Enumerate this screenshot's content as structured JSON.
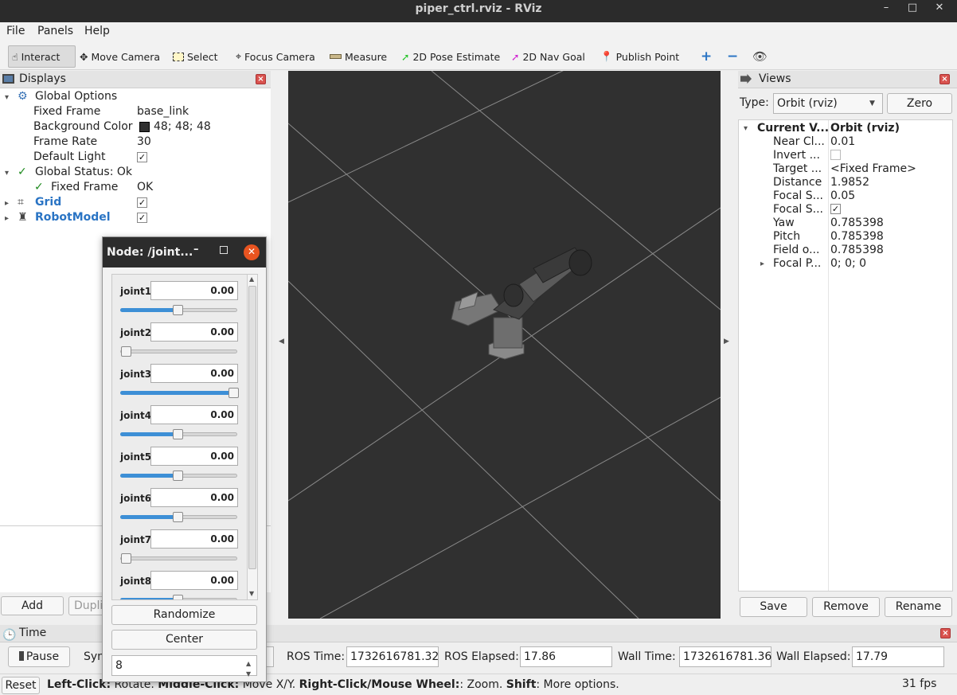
{
  "window": {
    "title": "piper_ctrl.rviz - RViz",
    "min": "–",
    "max": "□",
    "close": "✕"
  },
  "menu": {
    "file": "File",
    "panels": "Panels",
    "help": "Help"
  },
  "toolbar": {
    "interact": "Interact",
    "move_camera": "Move Camera",
    "select": "Select",
    "focus_camera": "Focus Camera",
    "measure": "Measure",
    "pose_estimate": "2D Pose Estimate",
    "nav_goal": "2D Nav Goal",
    "publish_point": "Publish Point"
  },
  "displays": {
    "title": "Displays",
    "global_options": "Global Options",
    "fixed_frame_label": "Fixed Frame",
    "fixed_frame_value": "base_link",
    "background_color_label": "Background Color",
    "background_color_value": "48; 48; 48",
    "background_swatch": "#303030",
    "frame_rate_label": "Frame Rate",
    "frame_rate_value": "30",
    "default_light_label": "Default Light",
    "global_status": "Global Status: Ok",
    "status_fixed_frame": "Fixed Frame",
    "status_fixed_frame_value": "OK",
    "grid": "Grid",
    "robot_model": "RobotModel",
    "add_button": "Add",
    "duplicate_button": "Dupli"
  },
  "node": {
    "title": "Node: /joint...",
    "joints": [
      {
        "name": "joint1",
        "value": "0.00",
        "level": 0.5
      },
      {
        "name": "joint2",
        "value": "0.00",
        "level": 0.0
      },
      {
        "name": "joint3",
        "value": "0.00",
        "level": 1.0
      },
      {
        "name": "joint4",
        "value": "0.00",
        "level": 0.5
      },
      {
        "name": "joint5",
        "value": "0.00",
        "level": 0.5
      },
      {
        "name": "joint6",
        "value": "0.00",
        "level": 0.5
      },
      {
        "name": "joint7",
        "value": "0.00",
        "level": 0.0
      },
      {
        "name": "joint8",
        "value": "0.00",
        "level": 0.5
      }
    ],
    "randomize": "Randomize",
    "center": "Center",
    "spin_value": "8"
  },
  "views": {
    "title": "Views",
    "type_label": "Type:",
    "type_value": "Orbit (rviz)",
    "zero_button": "Zero",
    "current_view": "Current V...",
    "current_view_value": "Orbit (rviz)",
    "near_clip": "Near Cl...",
    "near_clip_value": "0.01",
    "invert": "Invert ...",
    "target": "Target ...",
    "target_value": "<Fixed Frame>",
    "distance": "Distance",
    "distance_value": "1.9852",
    "focal_size": "Focal S...",
    "focal_size_value": "0.05",
    "focal_shape": "Focal S...",
    "yaw": "Yaw",
    "yaw_value": "0.785398",
    "pitch": "Pitch",
    "pitch_value": "0.785398",
    "fov": "Field o...",
    "fov_value": "0.785398",
    "focal_point": "Focal P...",
    "focal_point_value": "0; 0; 0",
    "save": "Save",
    "remove": "Remove",
    "rename": "Rename"
  },
  "time": {
    "title": "Time",
    "pause": "Pause",
    "sync": "Syn",
    "ros_time_label": "ROS Time:",
    "ros_time": "1732616781.32",
    "ros_elapsed_label": "ROS Elapsed:",
    "ros_elapsed": "17.86",
    "wall_time_label": "Wall Time:",
    "wall_time": "1732616781.36",
    "wall_elapsed_label": "Wall Elapsed:",
    "wall_elapsed": "17.79"
  },
  "status": {
    "reset": "Reset",
    "left_click": "Left-Click:",
    "left_text": " Rotate. ",
    "middle_click": "Middle-Click:",
    "middle_text": " Move X/Y. ",
    "right_click": "Right-Click/Mouse Wheel:",
    "right_text": ": Zoom. ",
    "shift": "Shift",
    "shift_text": ": More options.",
    "fps": "31 fps"
  }
}
